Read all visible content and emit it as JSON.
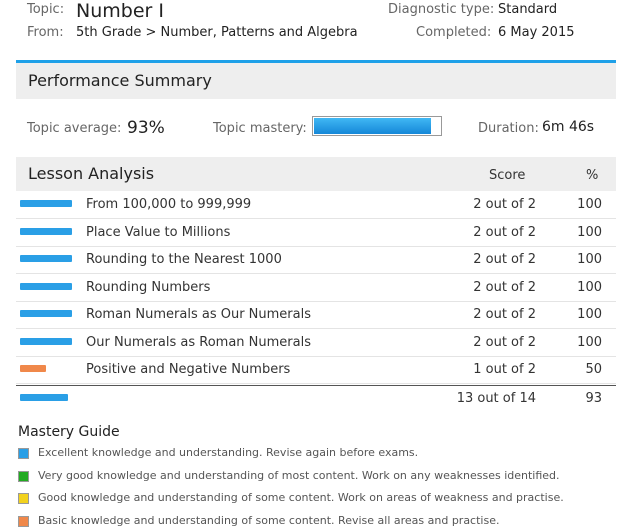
{
  "header": {
    "topic_label": "Topic:",
    "topic_value": "Number I",
    "from_label": "From:",
    "from_value": "5th Grade > Number, Patterns and Algebra",
    "diag_label": "Diagnostic type:",
    "diag_value": "Standard",
    "completed_label": "Completed:",
    "completed_value": "6 May 2015"
  },
  "performance": {
    "title": "Performance Summary",
    "avg_label": "Topic average:",
    "avg_value": "93%",
    "mastery_label": "Topic mastery:",
    "mastery_fraction": 0.93,
    "duration_label": "Duration:",
    "duration_value": "6m 46s"
  },
  "lessons": {
    "title": "Lesson Analysis",
    "col_score": "Score",
    "col_pct": "%",
    "rows": [
      {
        "name": "From 100,000 to 999,999",
        "score": "2 out of 2",
        "pct": "100",
        "level": "excellent"
      },
      {
        "name": "Place Value to Millions",
        "score": "2 out of 2",
        "pct": "100",
        "level": "excellent"
      },
      {
        "name": "Rounding to the Nearest 1000",
        "score": "2 out of 2",
        "pct": "100",
        "level": "excellent"
      },
      {
        "name": "Rounding Numbers",
        "score": "2 out of 2",
        "pct": "100",
        "level": "excellent"
      },
      {
        "name": "Roman Numerals as Our Numerals",
        "score": "2 out of 2",
        "pct": "100",
        "level": "excellent"
      },
      {
        "name": "Our Numerals as Roman Numerals",
        "score": "2 out of 2",
        "pct": "100",
        "level": "excellent"
      },
      {
        "name": "Positive and Negative Numbers",
        "score": "1 out of 2",
        "pct": "50",
        "level": "basic"
      }
    ],
    "total": {
      "score": "13 out of 14",
      "pct": "93",
      "level": "excellent"
    }
  },
  "guide": {
    "title": "Mastery Guide",
    "items": [
      {
        "text": "Excellent knowledge and understanding. Revise again before exams.",
        "color": "#2a9fe6"
      },
      {
        "text": "Very good knowledge and understanding of most content. Work on any weaknesses identified.",
        "color": "#22aa22"
      },
      {
        "text": "Good knowledge and understanding of some content. Work on areas of weakness and practise.",
        "color": "#f2d21e"
      },
      {
        "text": "Basic knowledge and understanding of some content. Revise all areas and practise.",
        "color": "#f0884a"
      }
    ]
  },
  "colors": {
    "excellent": "#2a9fe6",
    "basic": "#f0884a",
    "accent": "#1ea0e8"
  }
}
